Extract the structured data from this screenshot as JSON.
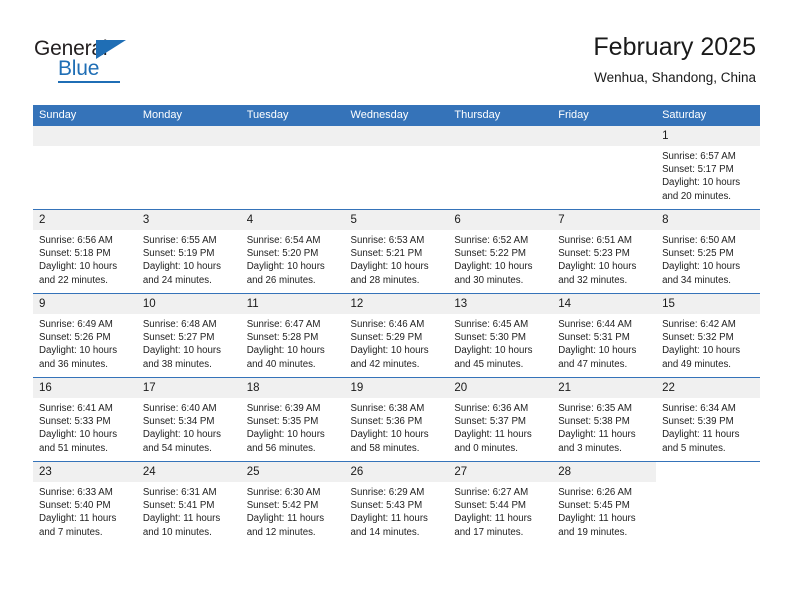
{
  "logo": {
    "primary_text": "General",
    "secondary_text": "Blue",
    "accent_color": "#1f6eb5"
  },
  "header": {
    "title": "February 2025",
    "subtitle": "Wenhua, Shandong, China"
  },
  "calendar": {
    "header_color": "#3573b9",
    "weekdays": [
      "Sunday",
      "Monday",
      "Tuesday",
      "Wednesday",
      "Thursday",
      "Friday",
      "Saturday"
    ],
    "labels": {
      "sunrise": "Sunrise:",
      "sunset": "Sunset:",
      "daylight": "Daylight:"
    },
    "weeks": [
      [
        {
          "day": "",
          "empty": true
        },
        {
          "day": "",
          "empty": true
        },
        {
          "day": "",
          "empty": true
        },
        {
          "day": "",
          "empty": true
        },
        {
          "day": "",
          "empty": true
        },
        {
          "day": "",
          "empty": true
        },
        {
          "day": "1",
          "sunrise": "Sunrise: 6:57 AM",
          "sunset": "Sunset: 5:17 PM",
          "daylight_1": "Daylight: 10 hours",
          "daylight_2": "and 20 minutes."
        }
      ],
      [
        {
          "day": "2",
          "sunrise": "Sunrise: 6:56 AM",
          "sunset": "Sunset: 5:18 PM",
          "daylight_1": "Daylight: 10 hours",
          "daylight_2": "and 22 minutes."
        },
        {
          "day": "3",
          "sunrise": "Sunrise: 6:55 AM",
          "sunset": "Sunset: 5:19 PM",
          "daylight_1": "Daylight: 10 hours",
          "daylight_2": "and 24 minutes."
        },
        {
          "day": "4",
          "sunrise": "Sunrise: 6:54 AM",
          "sunset": "Sunset: 5:20 PM",
          "daylight_1": "Daylight: 10 hours",
          "daylight_2": "and 26 minutes."
        },
        {
          "day": "5",
          "sunrise": "Sunrise: 6:53 AM",
          "sunset": "Sunset: 5:21 PM",
          "daylight_1": "Daylight: 10 hours",
          "daylight_2": "and 28 minutes."
        },
        {
          "day": "6",
          "sunrise": "Sunrise: 6:52 AM",
          "sunset": "Sunset: 5:22 PM",
          "daylight_1": "Daylight: 10 hours",
          "daylight_2": "and 30 minutes."
        },
        {
          "day": "7",
          "sunrise": "Sunrise: 6:51 AM",
          "sunset": "Sunset: 5:23 PM",
          "daylight_1": "Daylight: 10 hours",
          "daylight_2": "and 32 minutes."
        },
        {
          "day": "8",
          "sunrise": "Sunrise: 6:50 AM",
          "sunset": "Sunset: 5:25 PM",
          "daylight_1": "Daylight: 10 hours",
          "daylight_2": "and 34 minutes."
        }
      ],
      [
        {
          "day": "9",
          "sunrise": "Sunrise: 6:49 AM",
          "sunset": "Sunset: 5:26 PM",
          "daylight_1": "Daylight: 10 hours",
          "daylight_2": "and 36 minutes."
        },
        {
          "day": "10",
          "sunrise": "Sunrise: 6:48 AM",
          "sunset": "Sunset: 5:27 PM",
          "daylight_1": "Daylight: 10 hours",
          "daylight_2": "and 38 minutes."
        },
        {
          "day": "11",
          "sunrise": "Sunrise: 6:47 AM",
          "sunset": "Sunset: 5:28 PM",
          "daylight_1": "Daylight: 10 hours",
          "daylight_2": "and 40 minutes."
        },
        {
          "day": "12",
          "sunrise": "Sunrise: 6:46 AM",
          "sunset": "Sunset: 5:29 PM",
          "daylight_1": "Daylight: 10 hours",
          "daylight_2": "and 42 minutes."
        },
        {
          "day": "13",
          "sunrise": "Sunrise: 6:45 AM",
          "sunset": "Sunset: 5:30 PM",
          "daylight_1": "Daylight: 10 hours",
          "daylight_2": "and 45 minutes."
        },
        {
          "day": "14",
          "sunrise": "Sunrise: 6:44 AM",
          "sunset": "Sunset: 5:31 PM",
          "daylight_1": "Daylight: 10 hours",
          "daylight_2": "and 47 minutes."
        },
        {
          "day": "15",
          "sunrise": "Sunrise: 6:42 AM",
          "sunset": "Sunset: 5:32 PM",
          "daylight_1": "Daylight: 10 hours",
          "daylight_2": "and 49 minutes."
        }
      ],
      [
        {
          "day": "16",
          "sunrise": "Sunrise: 6:41 AM",
          "sunset": "Sunset: 5:33 PM",
          "daylight_1": "Daylight: 10 hours",
          "daylight_2": "and 51 minutes."
        },
        {
          "day": "17",
          "sunrise": "Sunrise: 6:40 AM",
          "sunset": "Sunset: 5:34 PM",
          "daylight_1": "Daylight: 10 hours",
          "daylight_2": "and 54 minutes."
        },
        {
          "day": "18",
          "sunrise": "Sunrise: 6:39 AM",
          "sunset": "Sunset: 5:35 PM",
          "daylight_1": "Daylight: 10 hours",
          "daylight_2": "and 56 minutes."
        },
        {
          "day": "19",
          "sunrise": "Sunrise: 6:38 AM",
          "sunset": "Sunset: 5:36 PM",
          "daylight_1": "Daylight: 10 hours",
          "daylight_2": "and 58 minutes."
        },
        {
          "day": "20",
          "sunrise": "Sunrise: 6:36 AM",
          "sunset": "Sunset: 5:37 PM",
          "daylight_1": "Daylight: 11 hours",
          "daylight_2": "and 0 minutes."
        },
        {
          "day": "21",
          "sunrise": "Sunrise: 6:35 AM",
          "sunset": "Sunset: 5:38 PM",
          "daylight_1": "Daylight: 11 hours",
          "daylight_2": "and 3 minutes."
        },
        {
          "day": "22",
          "sunrise": "Sunrise: 6:34 AM",
          "sunset": "Sunset: 5:39 PM",
          "daylight_1": "Daylight: 11 hours",
          "daylight_2": "and 5 minutes."
        }
      ],
      [
        {
          "day": "23",
          "sunrise": "Sunrise: 6:33 AM",
          "sunset": "Sunset: 5:40 PM",
          "daylight_1": "Daylight: 11 hours",
          "daylight_2": "and 7 minutes."
        },
        {
          "day": "24",
          "sunrise": "Sunrise: 6:31 AM",
          "sunset": "Sunset: 5:41 PM",
          "daylight_1": "Daylight: 11 hours",
          "daylight_2": "and 10 minutes."
        },
        {
          "day": "25",
          "sunrise": "Sunrise: 6:30 AM",
          "sunset": "Sunset: 5:42 PM",
          "daylight_1": "Daylight: 11 hours",
          "daylight_2": "and 12 minutes."
        },
        {
          "day": "26",
          "sunrise": "Sunrise: 6:29 AM",
          "sunset": "Sunset: 5:43 PM",
          "daylight_1": "Daylight: 11 hours",
          "daylight_2": "and 14 minutes."
        },
        {
          "day": "27",
          "sunrise": "Sunrise: 6:27 AM",
          "sunset": "Sunset: 5:44 PM",
          "daylight_1": "Daylight: 11 hours",
          "daylight_2": "and 17 minutes."
        },
        {
          "day": "28",
          "sunrise": "Sunrise: 6:26 AM",
          "sunset": "Sunset: 5:45 PM",
          "daylight_1": "Daylight: 11 hours",
          "daylight_2": "and 19 minutes."
        },
        {
          "day": "",
          "blank": true
        }
      ]
    ]
  }
}
